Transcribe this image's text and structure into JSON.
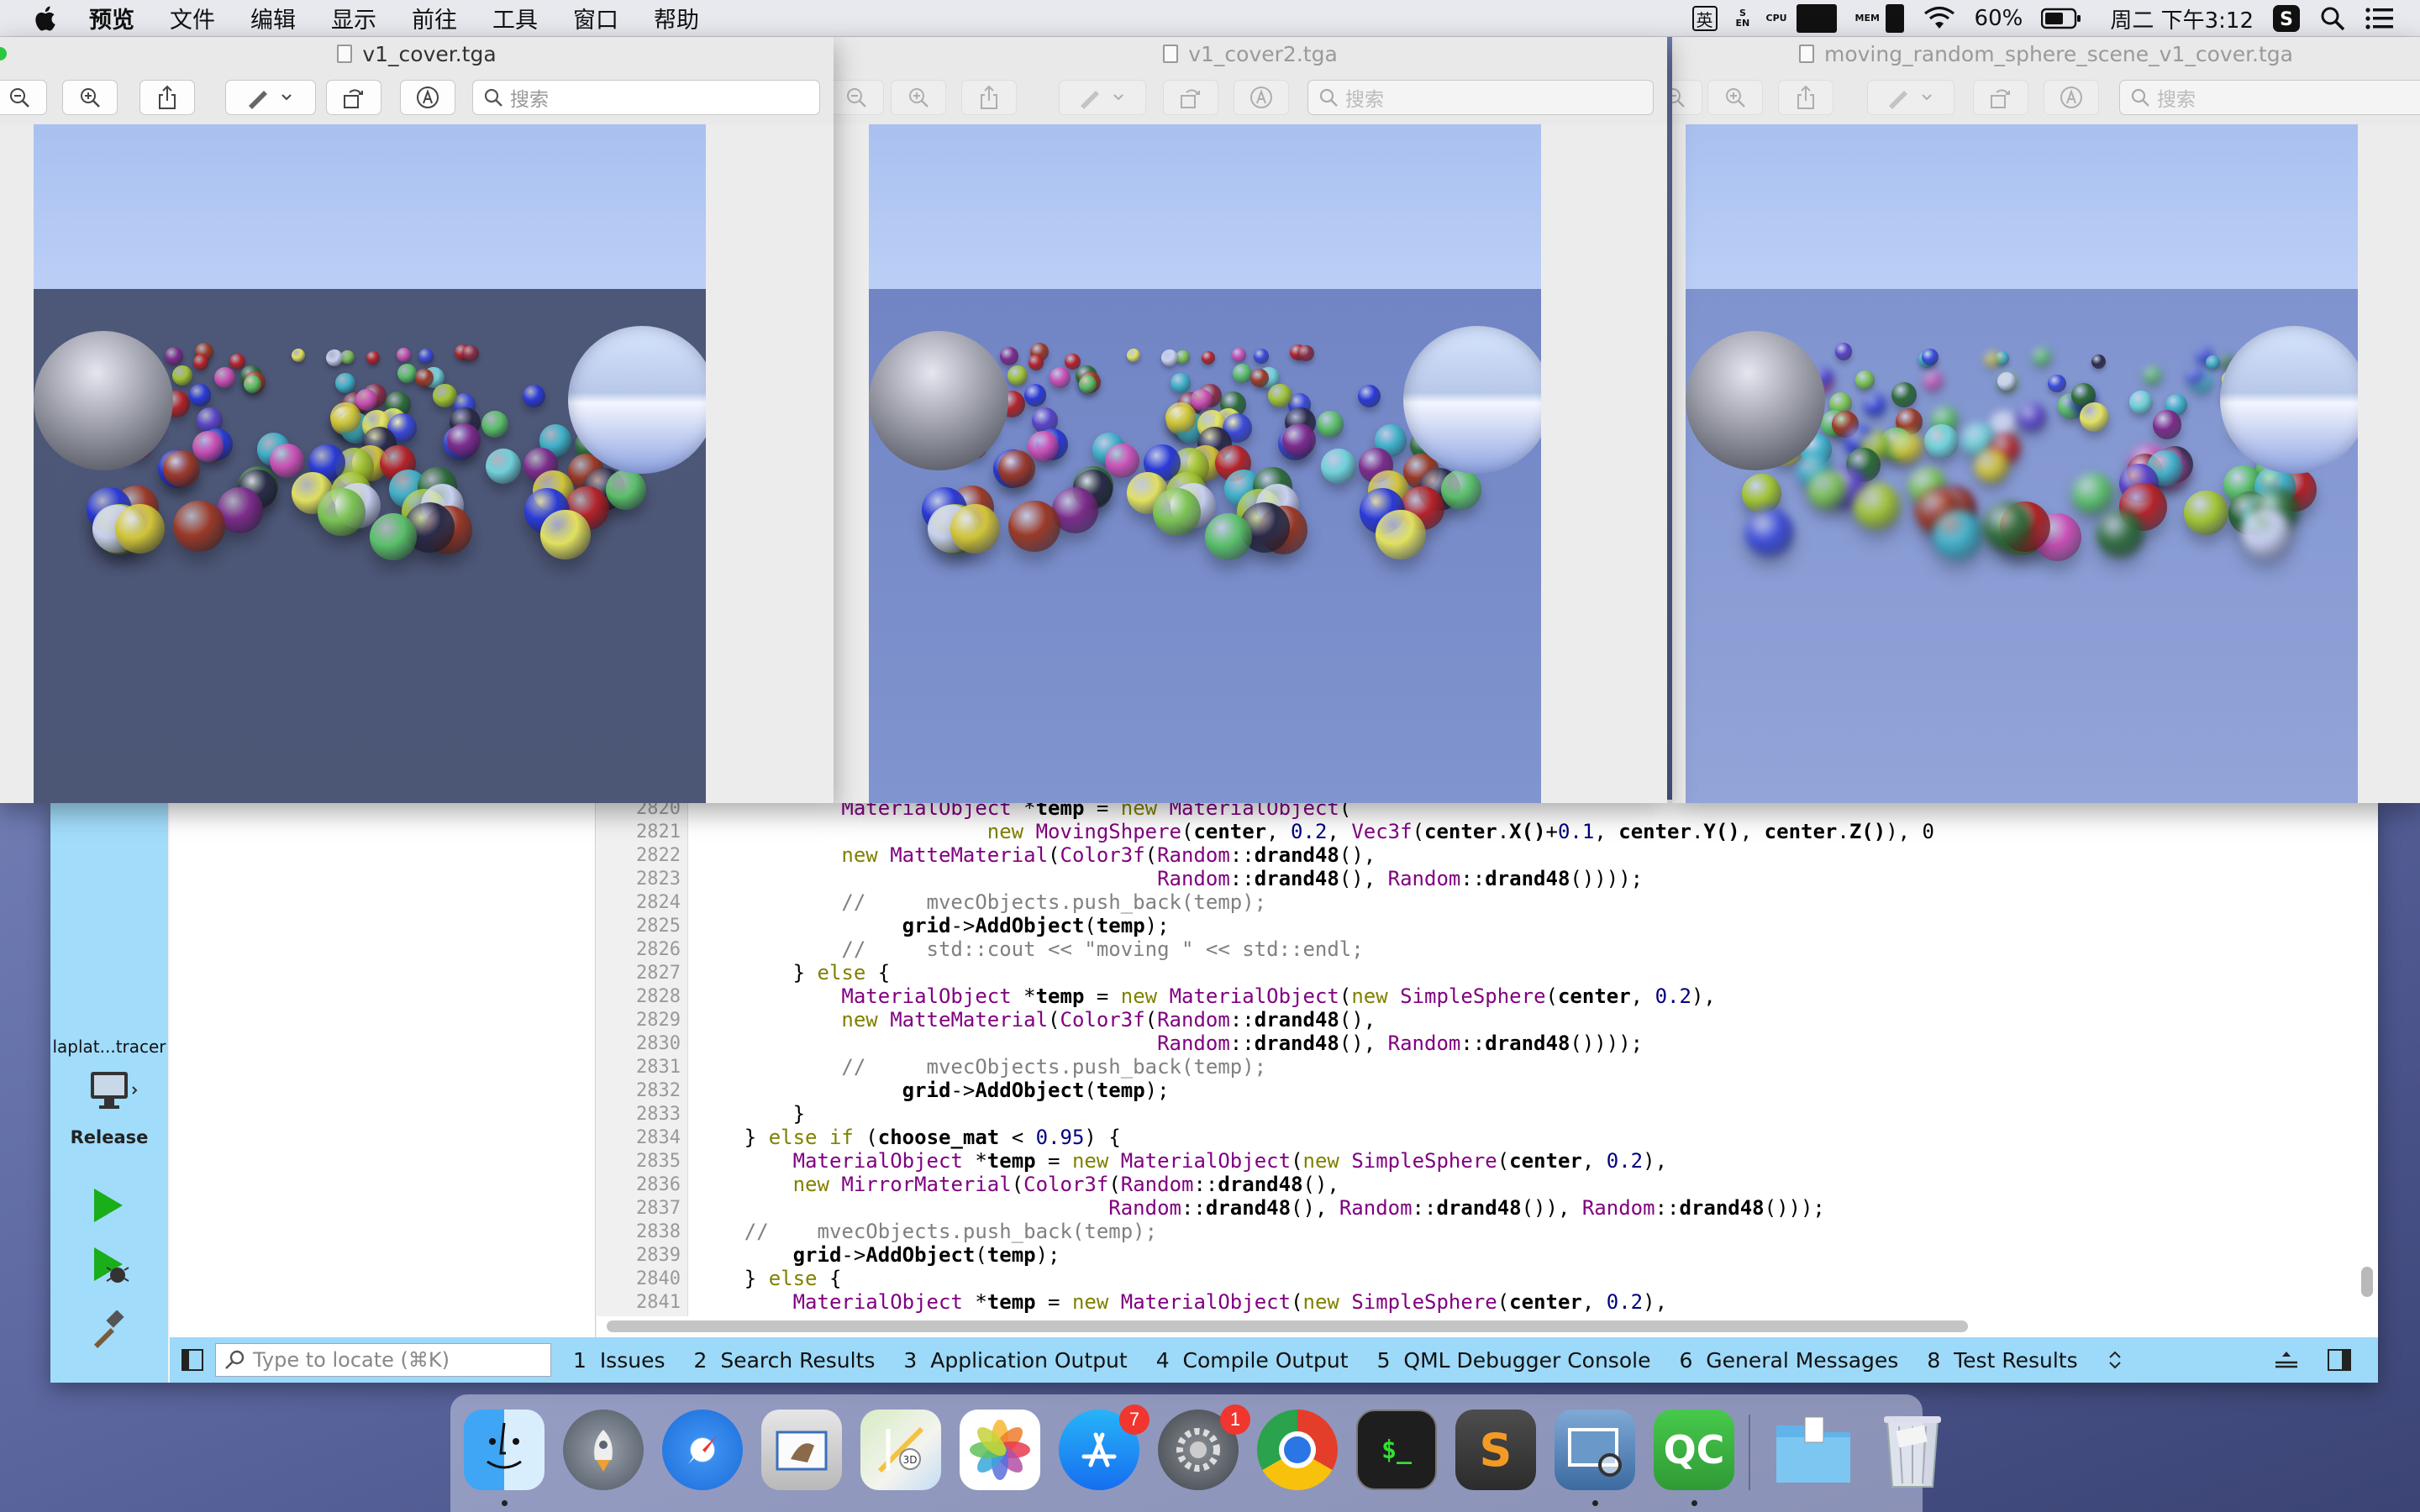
{
  "menubar": {
    "app_name": "预览",
    "items": [
      "文件",
      "编辑",
      "显示",
      "前往",
      "工具",
      "窗口",
      "帮助"
    ],
    "input_method": "英",
    "battery_percent": "60%",
    "clock": "周二 下午3:12",
    "status_vertical_1": "S EN",
    "status_vertical_2": "CPU",
    "status_vertical_3": "MEM"
  },
  "windows": [
    {
      "title": "v1_cover.tga",
      "search_placeholder": "搜索",
      "active": true
    },
    {
      "title": "v1_cover2.tga",
      "search_placeholder": "搜索",
      "active": false
    },
    {
      "title": "moving_random_sphere_scene_v1_cover.tga",
      "search_placeholder": "搜索",
      "active": false
    }
  ],
  "qt": {
    "project_name": "laplat...tracer",
    "build_config": "Release",
    "editor": {
      "lines": [
        {
          "n": "2820",
          "t": "            MaterialObject *temp = new MaterialObject("
        },
        {
          "n": "2821",
          "t": "                        new MovingShpere(center, 0.2, Vec3f(center.X()+0.1, center.Y(), center.Z()), 0"
        },
        {
          "n": "2822",
          "t": "            new MatteMaterial(Color3f(Random::drand48(),"
        },
        {
          "n": "2823",
          "t": "                                      Random::drand48(), Random::drand48())));"
        },
        {
          "n": "2824",
          "t": "            //     mvecObjects.push_back(temp);"
        },
        {
          "n": "2825",
          "t": "                 grid->AddObject(temp);"
        },
        {
          "n": "2826",
          "t": "            //     std::cout << \"moving \" << std::endl;"
        },
        {
          "n": "2827",
          "t": "        } else {"
        },
        {
          "n": "2828",
          "t": "            MaterialObject *temp = new MaterialObject(new SimpleSphere(center, 0.2),"
        },
        {
          "n": "2829",
          "t": "            new MatteMaterial(Color3f(Random::drand48(),"
        },
        {
          "n": "2830",
          "t": "                                      Random::drand48(), Random::drand48())));"
        },
        {
          "n": "2831",
          "t": "            //     mvecObjects.push_back(temp);"
        },
        {
          "n": "2832",
          "t": "                 grid->AddObject(temp);"
        },
        {
          "n": "2833",
          "t": "        }"
        },
        {
          "n": "2834",
          "t": "    } else if (choose_mat < 0.95) {"
        },
        {
          "n": "2835",
          "t": "        MaterialObject *temp = new MaterialObject(new SimpleSphere(center, 0.2),"
        },
        {
          "n": "2836",
          "t": "        new MirrorMaterial(Color3f(Random::drand48(),"
        },
        {
          "n": "2837",
          "t": "                                  Random::drand48(), Random::drand48()), Random::drand48()));"
        },
        {
          "n": "2838",
          "t": "    //    mvecObjects.push_back(temp);"
        },
        {
          "n": "2839",
          "t": "        grid->AddObject(temp);"
        },
        {
          "n": "2840",
          "t": "    } else {"
        },
        {
          "n": "2841",
          "t": "        MaterialObject *temp = new MaterialObject(new SimpleSphere(center, 0.2),"
        }
      ]
    },
    "locate_placeholder": "Type to locate (⌘K)",
    "output_panes": [
      {
        "num": "1",
        "label": "Issues"
      },
      {
        "num": "2",
        "label": "Search Results"
      },
      {
        "num": "3",
        "label": "Application Output"
      },
      {
        "num": "4",
        "label": "Compile Output"
      },
      {
        "num": "5",
        "label": "QML Debugger Console"
      },
      {
        "num": "6",
        "label": "General Messages"
      },
      {
        "num": "8",
        "label": "Test Results"
      }
    ]
  },
  "dock": {
    "apps": [
      "Finder",
      "Launchpad",
      "Safari",
      "Mail",
      "Maps",
      "Photos",
      "App Store",
      "System Preferences",
      "Chrome",
      "Terminal",
      "Sublime Text",
      "Preview",
      "Qt Creator",
      "Downloads",
      "Trash"
    ],
    "app_store_badge": "7",
    "sysprefs_badge": "1",
    "terminal_glyph": "$_",
    "qt_glyph": "QC",
    "sublime_glyph": "S"
  }
}
